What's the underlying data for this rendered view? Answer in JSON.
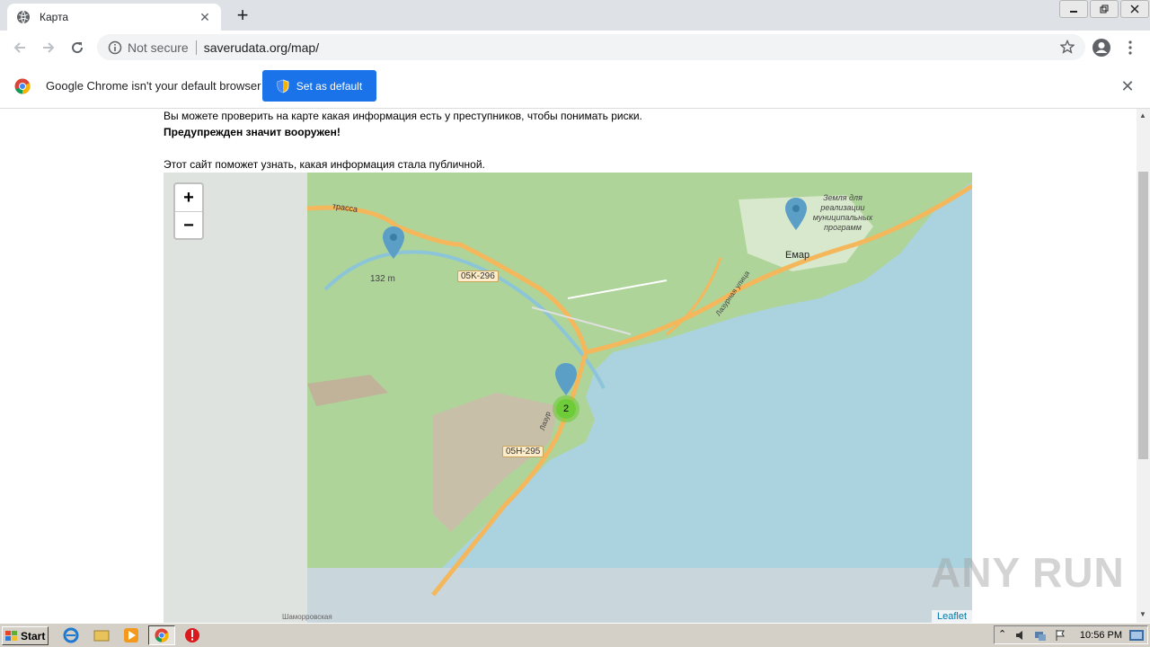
{
  "browser": {
    "tab_title": "Карта",
    "tab_close": "✕",
    "new_tab": "+",
    "omnibox_security": "Not secure",
    "omnibox_url": "saverudata.org/map/"
  },
  "infobar": {
    "message": "Google Chrome isn't your default browser",
    "button_label": "Set as default",
    "close": "✕"
  },
  "page": {
    "line1": "Вы можете проверить на карте какая информация есть у преступников, чтобы понимать риски.",
    "line2": "Предупрежден значит вооружен!",
    "line3": "Этот сайт поможет узнать, какая информация стала публичной."
  },
  "map": {
    "zoom_in": "+",
    "zoom_out": "−",
    "attribution": "Leaflet",
    "labels": {
      "road1": "05K-296",
      "road2": "05H-295",
      "town": "Емар",
      "area": "Земля для реализации муниципальных программ",
      "height": "132 m",
      "trassa": "трасса",
      "cluster_count": "2",
      "street1": "Лазурная улица",
      "street2": "Лазур",
      "bottom_road": "Шаморровская"
    },
    "colors": {
      "forest": "#aed49a",
      "sea": "#aad3df",
      "road": "#f4b75c"
    }
  },
  "watermark": "ANY RUN",
  "taskbar": {
    "start": "Start",
    "clock": "10:56 PM"
  }
}
